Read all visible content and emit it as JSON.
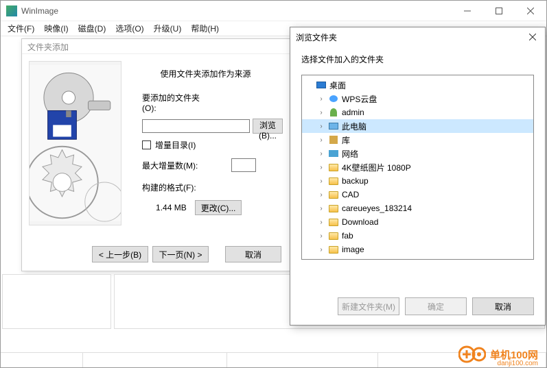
{
  "app": {
    "title": "WinImage"
  },
  "menu": {
    "file": "文件(F)",
    "image": "映像(I)",
    "disk": "磁盘(D)",
    "options": "选项(O)",
    "upgrade": "升级(U)",
    "help": "帮助(H)"
  },
  "wizard": {
    "title": "文件夹添加",
    "heading": "使用文件夹添加作为来源",
    "folder_label": "要添加的文件夹(O):",
    "browse_label": "浏览(B)...",
    "incremental_label": "增量目录(I)",
    "max_inc_label": "最大增量数(M):",
    "format_label": "构建的格式(F):",
    "size_value": "1.44 MB",
    "change_label": "更改(C)...",
    "back_label": "< 上一步(B)",
    "next_label": "下一页(N) >",
    "cancel_label": "取消"
  },
  "browse": {
    "title": "浏览文件夹",
    "subtitle": "选择文件加入的文件夹",
    "new_folder_label": "新建文件夹(M)",
    "ok_label": "确定",
    "cancel_label": "取消",
    "tree": [
      {
        "label": "桌面",
        "icon": "desktop",
        "depth": 0,
        "expander": ""
      },
      {
        "label": "WPS云盘",
        "icon": "cloud",
        "depth": 1,
        "expander": "›"
      },
      {
        "label": "admin",
        "icon": "user",
        "depth": 1,
        "expander": "›"
      },
      {
        "label": "此电脑",
        "icon": "pc",
        "depth": 1,
        "expander": "›",
        "selected": true
      },
      {
        "label": "库",
        "icon": "lib",
        "depth": 1,
        "expander": "›"
      },
      {
        "label": "网络",
        "icon": "net",
        "depth": 1,
        "expander": "›"
      },
      {
        "label": "4K壁纸图片 1080P",
        "icon": "folder",
        "depth": 1,
        "expander": "›"
      },
      {
        "label": "backup",
        "icon": "folder",
        "depth": 1,
        "expander": "›"
      },
      {
        "label": "CAD",
        "icon": "folder",
        "depth": 1,
        "expander": "›"
      },
      {
        "label": "careueyes_183214",
        "icon": "folder",
        "depth": 1,
        "expander": "›"
      },
      {
        "label": "Download",
        "icon": "folder",
        "depth": 1,
        "expander": "›"
      },
      {
        "label": "fab",
        "icon": "folder",
        "depth": 1,
        "expander": "›"
      },
      {
        "label": "image",
        "icon": "folder",
        "depth": 1,
        "expander": "›"
      }
    ]
  },
  "watermark": {
    "text": "单机100网",
    "sub": "danji100.com"
  }
}
